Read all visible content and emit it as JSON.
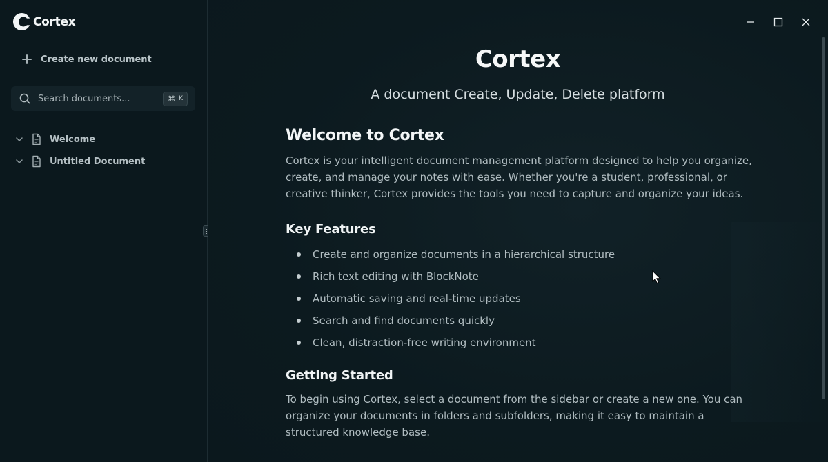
{
  "app": {
    "name": "Cortex"
  },
  "sidebar": {
    "create_label": "Create new document",
    "search": {
      "placeholder": "Search documents...",
      "shortcut_symbol": "⌘",
      "shortcut_key": "K"
    },
    "documents": [
      {
        "label": "Welcome"
      },
      {
        "label": "Untitled Document"
      }
    ]
  },
  "window_controls": {
    "minimize": "minimize-icon",
    "maximize": "maximize-icon",
    "close": "close-icon"
  },
  "main": {
    "title": "Cortex",
    "subtitle": "A document Create, Update, Delete platform",
    "welcome_heading": "Welcome to Cortex",
    "welcome_text": "Cortex is your intelligent document management platform designed to help you organize, create, and manage your notes with ease. Whether you're a student, professional, or creative thinker, Cortex provides the tools you need to capture and organize your ideas.",
    "features_heading": "Key Features",
    "features": [
      "Create and organize documents in a hierarchical structure",
      "Rich text editing with BlockNote",
      "Automatic saving and real-time updates",
      "Search and find documents quickly",
      "Clean, distraction-free writing environment"
    ],
    "started_heading": "Getting Started",
    "started_text": "To begin using Cortex, select a document from the sidebar or create a new one. You can organize your documents in folders and subfolders, making it easy to maintain a structured knowledge base."
  }
}
